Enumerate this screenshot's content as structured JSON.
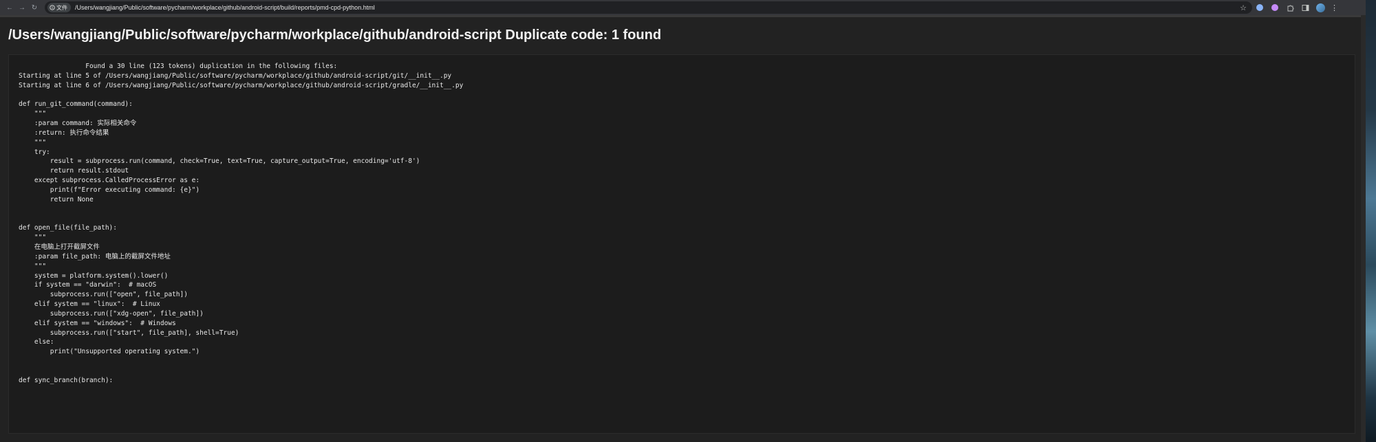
{
  "browser": {
    "chip_label": "文件",
    "url": "/Users/wangjiang/Public/software/pycharm/workplace/github/android-script/build/reports/pmd-cpd-python.html",
    "icons": [
      "back-arrow-icon",
      "forward-arrow-icon",
      "reload-icon",
      "info-icon",
      "star-icon",
      "extension-icons",
      "puzzle-icon",
      "sidebar-icon",
      "avatar",
      "menu-icon"
    ]
  },
  "page": {
    "title": "/Users/wangjiang/Public/software/pycharm/workplace/github/android-script Duplicate code: 1 found",
    "code_lines": [
      "                 Found a 30 line (123 tokens) duplication in the following files: ",
      "Starting at line 5 of /Users/wangjiang/Public/software/pycharm/workplace/github/android-script/git/__init__.py",
      "Starting at line 6 of /Users/wangjiang/Public/software/pycharm/workplace/github/android-script/gradle/__init__.py",
      "",
      "def run_git_command(command):",
      "    \"\"\"",
      "    :param command: 实际相关命令",
      "    :return: 执行命令结果",
      "    \"\"\"",
      "    try:",
      "        result = subprocess.run(command, check=True, text=True, capture_output=True, encoding='utf-8')",
      "        return result.stdout",
      "    except subprocess.CalledProcessError as e:",
      "        print(f\"Error executing command: {e}\")",
      "        return None",
      "",
      "",
      "def open_file(file_path):",
      "    \"\"\"",
      "    在电脑上打开截屏文件",
      "    :param file_path: 电脑上的截屏文件地址",
      "    \"\"\"",
      "    system = platform.system().lower()",
      "    if system == \"darwin\":  # macOS",
      "        subprocess.run([\"open\", file_path])",
      "    elif system == \"linux\":  # Linux",
      "        subprocess.run([\"xdg-open\", file_path])",
      "    elif system == \"windows\":  # Windows",
      "        subprocess.run([\"start\", file_path], shell=True)",
      "    else:",
      "        print(\"Unsupported operating system.\")",
      "",
      "",
      "def sync_branch(branch):"
    ]
  },
  "colors": {
    "page_bg": "#222222",
    "code_bg": "#1c1c1c",
    "text": "#e8e8e8",
    "chrome_bg": "#35363a"
  }
}
